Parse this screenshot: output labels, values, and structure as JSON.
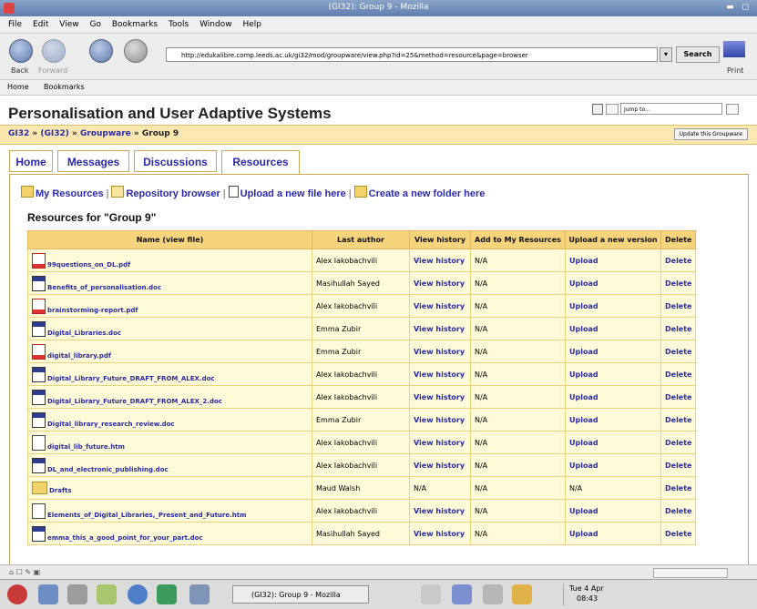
{
  "window": {
    "title": "(GI32): Group 9 - Mozilla"
  },
  "menu": [
    "File",
    "Edit",
    "View",
    "Go",
    "Bookmarks",
    "Tools",
    "Window",
    "Help"
  ],
  "nav": {
    "back_label": "Back",
    "forward_label": "Forward",
    "url": "http://edukalibre.comp.leeds.ac.uk/gi32/mod/groupware/view.php?id=25&method=resource&page=browser",
    "search_label": "Search",
    "print_label": "Print"
  },
  "bookmarks": {
    "home": "Home",
    "bookmarks": "Bookmarks"
  },
  "page": {
    "site_title": "Personalisation and User Adaptive Systems",
    "jump_placeholder": "Jump to...",
    "breadcrumb": [
      {
        "label": "GI32"
      },
      {
        "label": "(GI32)"
      },
      {
        "label": "Groupware"
      },
      {
        "label": "Group 9"
      }
    ],
    "breadcrumb_sep": "»",
    "update_button": "Update this Groupware",
    "tabs": [
      "Home",
      "Messages",
      "Discussions",
      "Resources"
    ],
    "actions": {
      "my_resources": "My Resources",
      "repository": "Repository browser",
      "upload": "Upload a new file here",
      "create": "Create a new folder here",
      "sep": "|"
    },
    "resources_heading": "Resources for \"Group 9\"",
    "table": {
      "headers": [
        "Name (view file)",
        "Last author",
        "View history",
        "Add to My Resources",
        "Upload a new version",
        "Delete"
      ],
      "rows": [
        {
          "icon": "pdf-icon",
          "name": "99questions_on_DL.pdf",
          "author": "Alex Iakobachvili",
          "history": "View history",
          "add": "N/A",
          "upload": "Upload",
          "delete": "Delete"
        },
        {
          "icon": "doc-icon",
          "name": "Benefits_of_personalisation.doc",
          "author": "Masihullah Sayed",
          "history": "View history",
          "add": "N/A",
          "upload": "Upload",
          "delete": "Delete"
        },
        {
          "icon": "pdf-icon",
          "name": "brainstorming-report.pdf",
          "author": "Alex Iakobachvili",
          "history": "View history",
          "add": "N/A",
          "upload": "Upload",
          "delete": "Delete"
        },
        {
          "icon": "doc-icon",
          "name": "Digital_Libraries.doc",
          "author": "Emma Zubir",
          "history": "View history",
          "add": "N/A",
          "upload": "Upload",
          "delete": "Delete"
        },
        {
          "icon": "pdf-icon",
          "name": "digital_library.pdf",
          "author": "Emma Zubir",
          "history": "View history",
          "add": "N/A",
          "upload": "Upload",
          "delete": "Delete"
        },
        {
          "icon": "doc-icon",
          "name": "Digital_Library_Future_DRAFT_FROM_ALEX.doc",
          "author": "Alex Iakobachvili",
          "history": "View history",
          "add": "N/A",
          "upload": "Upload",
          "delete": "Delete"
        },
        {
          "icon": "doc-icon",
          "name": "Digital_Library_Future_DRAFT_FROM_ALEX_2.doc",
          "author": "Alex Iakobachvili",
          "history": "View history",
          "add": "N/A",
          "upload": "Upload",
          "delete": "Delete"
        },
        {
          "icon": "doc-icon",
          "name": "Digital_library_research_review.doc",
          "author": "Emma Zubir",
          "history": "View history",
          "add": "N/A",
          "upload": "Upload",
          "delete": "Delete"
        },
        {
          "icon": "htm-icon",
          "name": "digital_lib_future.htm",
          "author": "Alex Iakobachvili",
          "history": "View history",
          "add": "N/A",
          "upload": "Upload",
          "delete": "Delete"
        },
        {
          "icon": "doc-icon",
          "name": "DL_and_electronic_publishing.doc",
          "author": "Alex Iakobachvili",
          "history": "View history",
          "add": "N/A",
          "upload": "Upload",
          "delete": "Delete"
        },
        {
          "icon": "folder-icon",
          "name": "Drafts",
          "author": "Maud Walsh",
          "history": "N/A",
          "add": "N/A",
          "upload": "N/A",
          "delete": "Delete"
        },
        {
          "icon": "htm-icon",
          "name": "Elements_of_Digital_Libraries,_Present_and_Future.htm",
          "author": "Alex Iakobachvili",
          "history": "View history",
          "add": "N/A",
          "upload": "Upload",
          "delete": "Delete"
        },
        {
          "icon": "doc-icon",
          "name": "emma_this_a_good_point_for_your_part.doc",
          "author": "Masihullah Sayed",
          "history": "View history",
          "add": "N/A",
          "upload": "Upload",
          "delete": "Delete"
        }
      ]
    }
  },
  "taskbar": {
    "task": "(GI32): Group 9 - Mozilla",
    "clock_day": "Tue 4 Apr",
    "clock_time": "08:43"
  }
}
